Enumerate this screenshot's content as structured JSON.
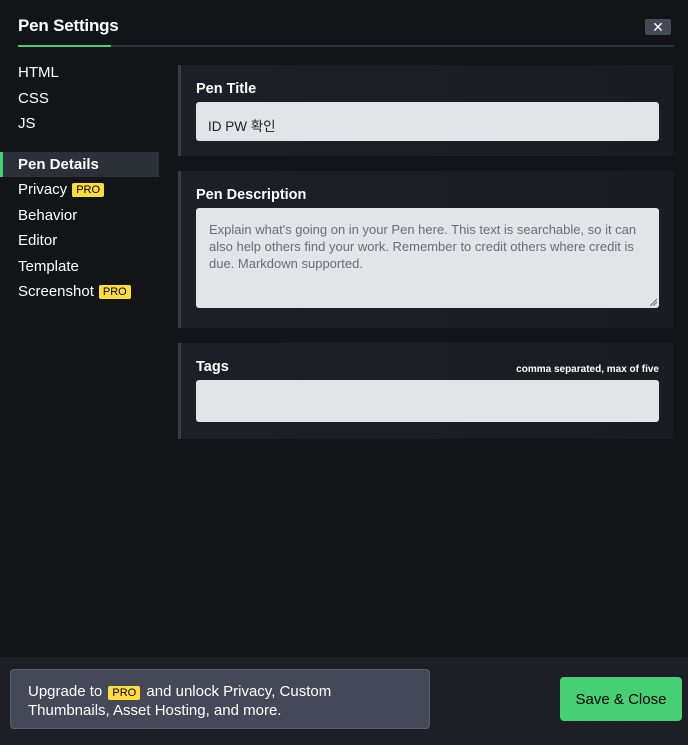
{
  "header": {
    "title": "Pen Settings",
    "close_symbol": "✕"
  },
  "sidebar": {
    "group_code": [
      {
        "label": "HTML"
      },
      {
        "label": "CSS"
      },
      {
        "label": "JS"
      }
    ],
    "group_settings": [
      {
        "label": "Pen Details",
        "active": true
      },
      {
        "label": "Privacy",
        "badge": "PRO"
      },
      {
        "label": "Behavior"
      },
      {
        "label": "Editor"
      },
      {
        "label": "Template"
      },
      {
        "label": "Screenshot",
        "badge": "PRO"
      }
    ]
  },
  "pen_title": {
    "label": "Pen Title",
    "value": "ID PW 확인"
  },
  "pen_description": {
    "label": "Pen Description",
    "placeholder": "Explain what's going on in your Pen here. This text is searchable, so it can also help others find your work. Remember to credit others where credit is due. Markdown supported."
  },
  "tags": {
    "label": "Tags",
    "note": "comma separated, max of five",
    "value": ""
  },
  "footer": {
    "upgrade_prefix": "Upgrade to",
    "upgrade_badge": "PRO",
    "upgrade_suffix": "and unlock Privacy, Custom Thumbnails, Asset Hosting, and more.",
    "save_label": "Save & Close"
  },
  "colors": {
    "accent": "#47cf73",
    "pro_badge": "#ffdd40",
    "background": "#131417",
    "panel": "#1e1f26",
    "field": "#e3e4e8"
  }
}
